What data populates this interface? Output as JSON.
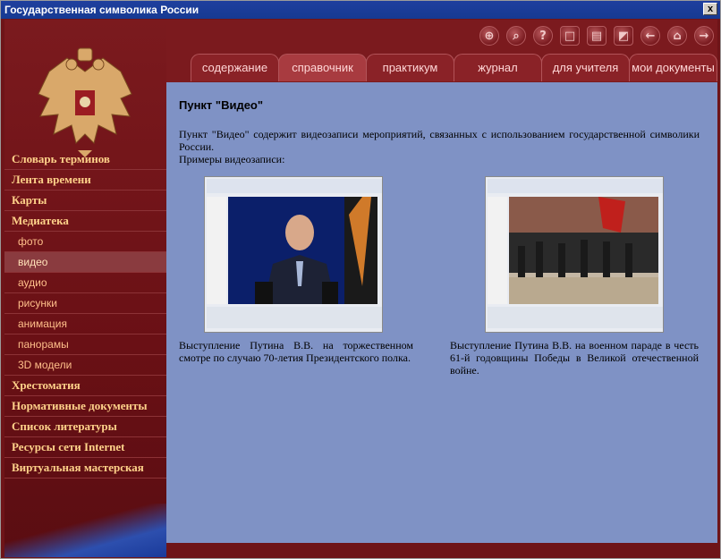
{
  "window": {
    "title": "Государственная символика России",
    "close_label": "x"
  },
  "sidebar": {
    "items": [
      {
        "label": "Словарь терминов",
        "level": 1
      },
      {
        "label": "Лента времени",
        "level": 1
      },
      {
        "label": "Карты",
        "level": 1
      },
      {
        "label": "Медиатека",
        "level": 1
      },
      {
        "label": "фото",
        "level": 2
      },
      {
        "label": "видео",
        "level": 2,
        "active": true
      },
      {
        "label": "аудио",
        "level": 2
      },
      {
        "label": "рисунки",
        "level": 2
      },
      {
        "label": "анимация",
        "level": 2
      },
      {
        "label": "панорамы",
        "level": 2
      },
      {
        "label": "3D модели",
        "level": 2
      },
      {
        "label": "Хрестоматия",
        "level": 1
      },
      {
        "label": "Нормативные документы",
        "level": 1
      },
      {
        "label": "Список литературы",
        "level": 1
      },
      {
        "label": "Ресурсы сети Internet",
        "level": 1
      },
      {
        "label": "Виртуальная мастерская",
        "level": 1
      }
    ]
  },
  "toolbar": {
    "icons": [
      "search-icon",
      "magnify-icon",
      "help-icon",
      "fullscreen-icon",
      "print-icon",
      "bookmark-icon",
      "back-icon",
      "home-icon",
      "forward-icon"
    ]
  },
  "tabs": [
    {
      "label": "содержание"
    },
    {
      "label": "справочник",
      "active": true
    },
    {
      "label": "практикум"
    },
    {
      "label": "журнал"
    },
    {
      "label": "для учителя"
    },
    {
      "label": "мои документы"
    }
  ],
  "content": {
    "heading": "Пункт \"Видео\"",
    "intro": "Пункт \"Видео\" содержит видеозаписи мероприятий, связанных с использованием государственной символики России.",
    "examples_label": "Примеры видеозаписи:",
    "videos": [
      {
        "caption": "Выступление Путина В.В. на торжественном смотре по случаю 70-летия Президентского полка."
      },
      {
        "caption": "Выступление Путина В.В. на военном параде в честь 61-й годовщины Победы в Великой отечественной войне."
      }
    ]
  },
  "colors": {
    "sidebar": "#6e1418",
    "content_bg": "#7f92c5",
    "menu_text": "#ffd28a"
  }
}
